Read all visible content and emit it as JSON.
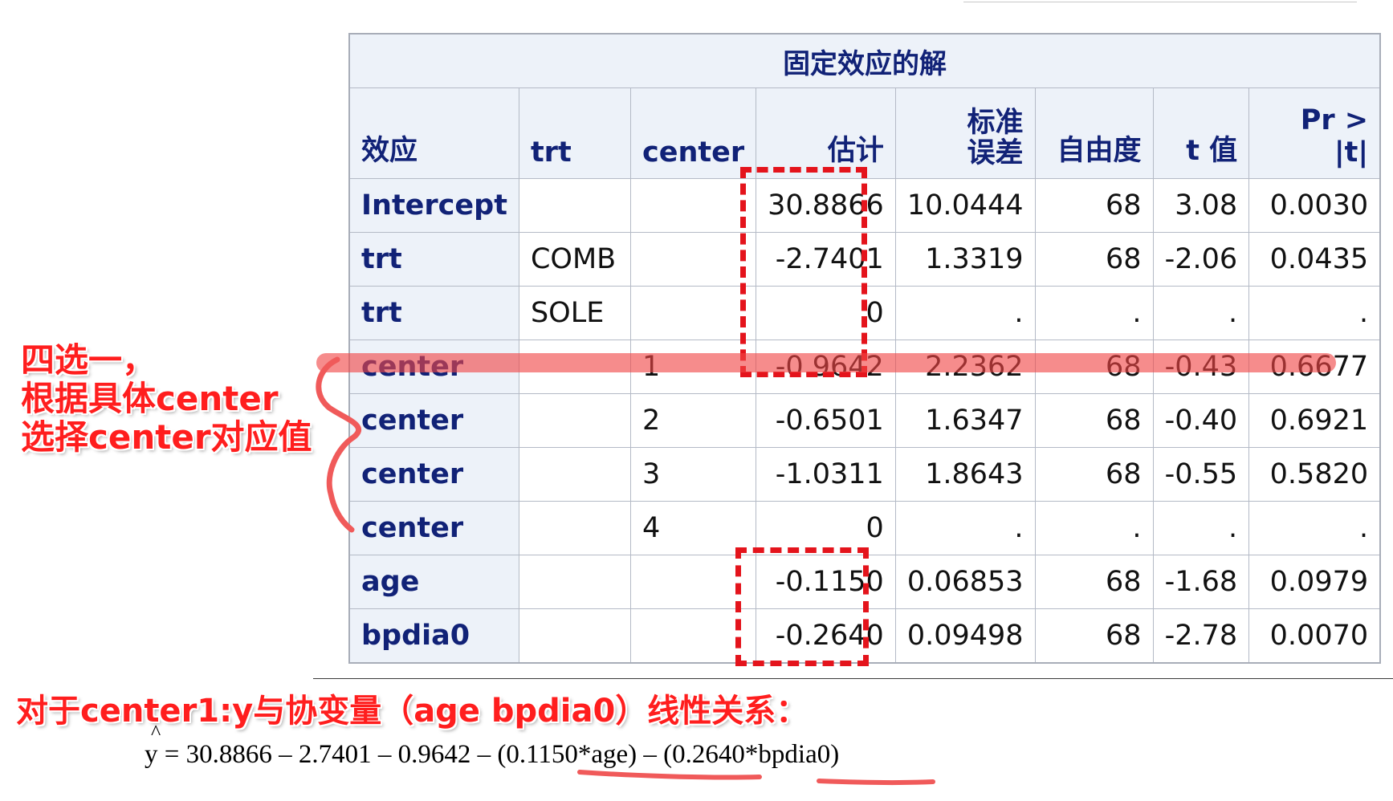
{
  "table": {
    "caption": "固定效应的解",
    "headers": [
      "效应",
      "trt",
      "center",
      "估计",
      "标准\n误差",
      "自由度",
      "t 值",
      "Pr > |t|"
    ],
    "rows": [
      [
        "Intercept",
        "",
        "",
        "30.8866",
        "10.0444",
        "68",
        "3.08",
        "0.0030"
      ],
      [
        "trt",
        "COMB",
        "",
        "-2.7401",
        "1.3319",
        "68",
        "-2.06",
        "0.0435"
      ],
      [
        "trt",
        "SOLE",
        "",
        "0",
        ".",
        ".",
        ".",
        "."
      ],
      [
        "center",
        "",
        "1",
        "-0.9642",
        "2.2362",
        "68",
        "-0.43",
        "0.6677"
      ],
      [
        "center",
        "",
        "2",
        "-0.6501",
        "1.6347",
        "68",
        "-0.40",
        "0.6921"
      ],
      [
        "center",
        "",
        "3",
        "-1.0311",
        "1.8643",
        "68",
        "-0.55",
        "0.5820"
      ],
      [
        "center",
        "",
        "4",
        "0",
        ".",
        ".",
        ".",
        "."
      ],
      [
        "age",
        "",
        "",
        "-0.1150",
        "0.06853",
        "68",
        "-1.68",
        "0.0979"
      ],
      [
        "bpdia0",
        "",
        "",
        "-0.2640",
        "0.09498",
        "68",
        "-2.78",
        "0.0070"
      ]
    ]
  },
  "annotations": {
    "left_line1": "四选一，",
    "left_line2": "根据具体center",
    "left_line3": "选择center对应值",
    "bottom": "对于center1:y与协变量（age bpdia0）线性关系："
  },
  "formula": {
    "hat": "^",
    "text": "y = 30.8866  –  2.7401  –  0.9642  –  (0.1150*age)  –  (0.2640*bpdia0)"
  },
  "colors": {
    "header_bg": "#edf2f9",
    "header_text": "#112277",
    "annotation_red": "#ff1e1e",
    "dash_red": "#e4141c",
    "highlight": "rgba(240,70,70,0.62)"
  }
}
